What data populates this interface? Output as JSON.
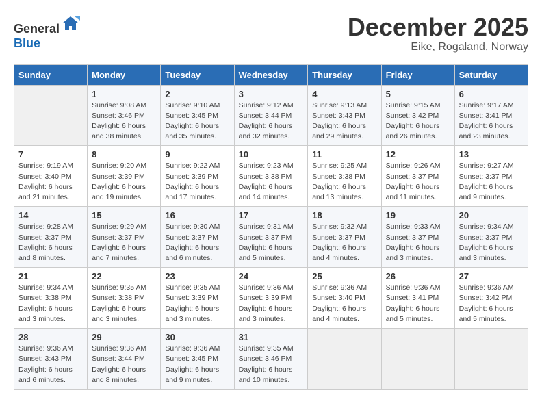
{
  "header": {
    "logo_general": "General",
    "logo_blue": "Blue",
    "month": "December 2025",
    "location": "Eike, Rogaland, Norway"
  },
  "weekdays": [
    "Sunday",
    "Monday",
    "Tuesday",
    "Wednesday",
    "Thursday",
    "Friday",
    "Saturday"
  ],
  "weeks": [
    [
      {
        "day": "",
        "sunrise": "",
        "sunset": "",
        "daylight": ""
      },
      {
        "day": "1",
        "sunrise": "Sunrise: 9:08 AM",
        "sunset": "Sunset: 3:46 PM",
        "daylight": "Daylight: 6 hours and 38 minutes."
      },
      {
        "day": "2",
        "sunrise": "Sunrise: 9:10 AM",
        "sunset": "Sunset: 3:45 PM",
        "daylight": "Daylight: 6 hours and 35 minutes."
      },
      {
        "day": "3",
        "sunrise": "Sunrise: 9:12 AM",
        "sunset": "Sunset: 3:44 PM",
        "daylight": "Daylight: 6 hours and 32 minutes."
      },
      {
        "day": "4",
        "sunrise": "Sunrise: 9:13 AM",
        "sunset": "Sunset: 3:43 PM",
        "daylight": "Daylight: 6 hours and 29 minutes."
      },
      {
        "day": "5",
        "sunrise": "Sunrise: 9:15 AM",
        "sunset": "Sunset: 3:42 PM",
        "daylight": "Daylight: 6 hours and 26 minutes."
      },
      {
        "day": "6",
        "sunrise": "Sunrise: 9:17 AM",
        "sunset": "Sunset: 3:41 PM",
        "daylight": "Daylight: 6 hours and 23 minutes."
      }
    ],
    [
      {
        "day": "7",
        "sunrise": "Sunrise: 9:19 AM",
        "sunset": "Sunset: 3:40 PM",
        "daylight": "Daylight: 6 hours and 21 minutes."
      },
      {
        "day": "8",
        "sunrise": "Sunrise: 9:20 AM",
        "sunset": "Sunset: 3:39 PM",
        "daylight": "Daylight: 6 hours and 19 minutes."
      },
      {
        "day": "9",
        "sunrise": "Sunrise: 9:22 AM",
        "sunset": "Sunset: 3:39 PM",
        "daylight": "Daylight: 6 hours and 17 minutes."
      },
      {
        "day": "10",
        "sunrise": "Sunrise: 9:23 AM",
        "sunset": "Sunset: 3:38 PM",
        "daylight": "Daylight: 6 hours and 14 minutes."
      },
      {
        "day": "11",
        "sunrise": "Sunrise: 9:25 AM",
        "sunset": "Sunset: 3:38 PM",
        "daylight": "Daylight: 6 hours and 13 minutes."
      },
      {
        "day": "12",
        "sunrise": "Sunrise: 9:26 AM",
        "sunset": "Sunset: 3:37 PM",
        "daylight": "Daylight: 6 hours and 11 minutes."
      },
      {
        "day": "13",
        "sunrise": "Sunrise: 9:27 AM",
        "sunset": "Sunset: 3:37 PM",
        "daylight": "Daylight: 6 hours and 9 minutes."
      }
    ],
    [
      {
        "day": "14",
        "sunrise": "Sunrise: 9:28 AM",
        "sunset": "Sunset: 3:37 PM",
        "daylight": "Daylight: 6 hours and 8 minutes."
      },
      {
        "day": "15",
        "sunrise": "Sunrise: 9:29 AM",
        "sunset": "Sunset: 3:37 PM",
        "daylight": "Daylight: 6 hours and 7 minutes."
      },
      {
        "day": "16",
        "sunrise": "Sunrise: 9:30 AM",
        "sunset": "Sunset: 3:37 PM",
        "daylight": "Daylight: 6 hours and 6 minutes."
      },
      {
        "day": "17",
        "sunrise": "Sunrise: 9:31 AM",
        "sunset": "Sunset: 3:37 PM",
        "daylight": "Daylight: 6 hours and 5 minutes."
      },
      {
        "day": "18",
        "sunrise": "Sunrise: 9:32 AM",
        "sunset": "Sunset: 3:37 PM",
        "daylight": "Daylight: 6 hours and 4 minutes."
      },
      {
        "day": "19",
        "sunrise": "Sunrise: 9:33 AM",
        "sunset": "Sunset: 3:37 PM",
        "daylight": "Daylight: 6 hours and 3 minutes."
      },
      {
        "day": "20",
        "sunrise": "Sunrise: 9:34 AM",
        "sunset": "Sunset: 3:37 PM",
        "daylight": "Daylight: 6 hours and 3 minutes."
      }
    ],
    [
      {
        "day": "21",
        "sunrise": "Sunrise: 9:34 AM",
        "sunset": "Sunset: 3:38 PM",
        "daylight": "Daylight: 6 hours and 3 minutes."
      },
      {
        "day": "22",
        "sunrise": "Sunrise: 9:35 AM",
        "sunset": "Sunset: 3:38 PM",
        "daylight": "Daylight: 6 hours and 3 minutes."
      },
      {
        "day": "23",
        "sunrise": "Sunrise: 9:35 AM",
        "sunset": "Sunset: 3:39 PM",
        "daylight": "Daylight: 6 hours and 3 minutes."
      },
      {
        "day": "24",
        "sunrise": "Sunrise: 9:36 AM",
        "sunset": "Sunset: 3:39 PM",
        "daylight": "Daylight: 6 hours and 3 minutes."
      },
      {
        "day": "25",
        "sunrise": "Sunrise: 9:36 AM",
        "sunset": "Sunset: 3:40 PM",
        "daylight": "Daylight: 6 hours and 4 minutes."
      },
      {
        "day": "26",
        "sunrise": "Sunrise: 9:36 AM",
        "sunset": "Sunset: 3:41 PM",
        "daylight": "Daylight: 6 hours and 5 minutes."
      },
      {
        "day": "27",
        "sunrise": "Sunrise: 9:36 AM",
        "sunset": "Sunset: 3:42 PM",
        "daylight": "Daylight: 6 hours and 5 minutes."
      }
    ],
    [
      {
        "day": "28",
        "sunrise": "Sunrise: 9:36 AM",
        "sunset": "Sunset: 3:43 PM",
        "daylight": "Daylight: 6 hours and 6 minutes."
      },
      {
        "day": "29",
        "sunrise": "Sunrise: 9:36 AM",
        "sunset": "Sunset: 3:44 PM",
        "daylight": "Daylight: 6 hours and 8 minutes."
      },
      {
        "day": "30",
        "sunrise": "Sunrise: 9:36 AM",
        "sunset": "Sunset: 3:45 PM",
        "daylight": "Daylight: 6 hours and 9 minutes."
      },
      {
        "day": "31",
        "sunrise": "Sunrise: 9:35 AM",
        "sunset": "Sunset: 3:46 PM",
        "daylight": "Daylight: 6 hours and 10 minutes."
      },
      {
        "day": "",
        "sunrise": "",
        "sunset": "",
        "daylight": ""
      },
      {
        "day": "",
        "sunrise": "",
        "sunset": "",
        "daylight": ""
      },
      {
        "day": "",
        "sunrise": "",
        "sunset": "",
        "daylight": ""
      }
    ]
  ]
}
